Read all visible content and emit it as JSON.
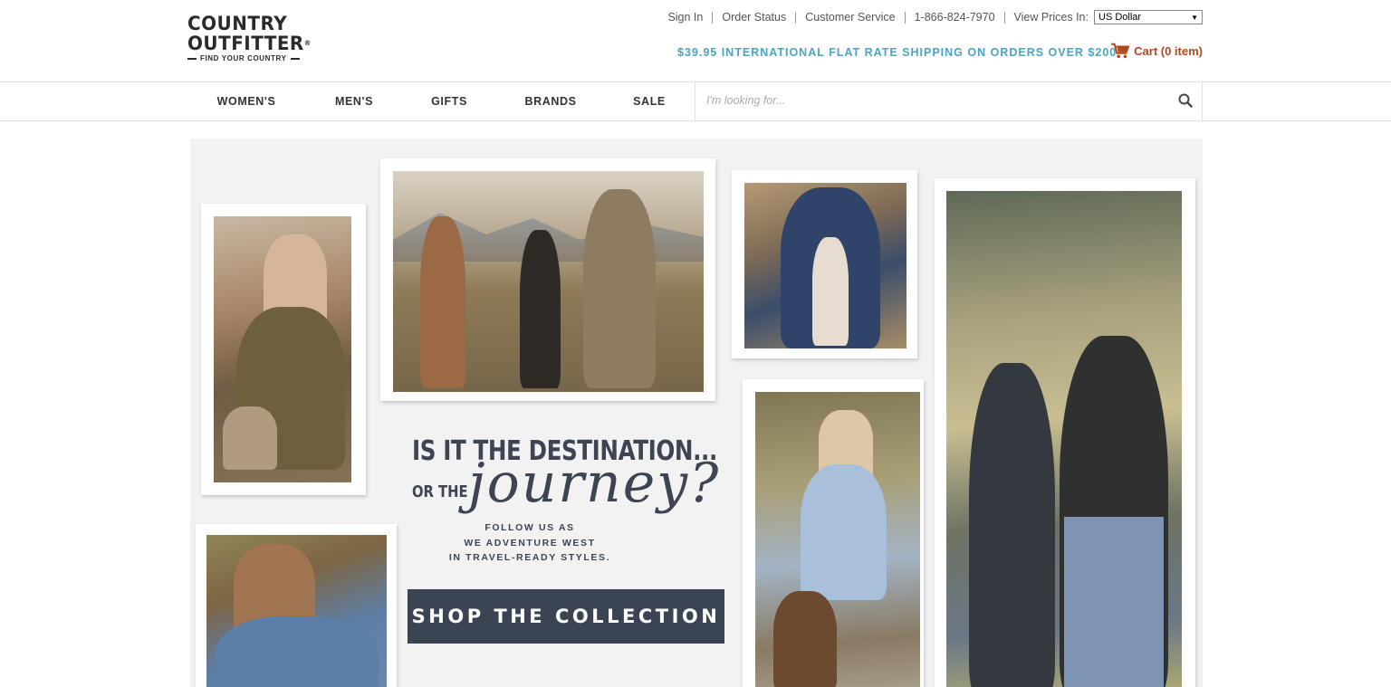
{
  "brand": {
    "line1": "COUNTRY",
    "line2": "OUTFITTER",
    "registered": "®",
    "tagline": "FIND YOUR COUNTRY"
  },
  "util_links": {
    "sign_in": "Sign In",
    "order_status": "Order Status",
    "customer_service": "Customer Service",
    "phone": "1-866-824-7970",
    "view_prices_label": "View Prices In:",
    "currency_value": "US Dollar"
  },
  "promo": "$39.95 INTERNATIONAL FLAT RATE SHIPPING ON ORDERS OVER $200",
  "cart": {
    "label": "Cart (0 item)"
  },
  "nav": {
    "items": [
      {
        "label": "WOMEN'S"
      },
      {
        "label": "MEN'S"
      },
      {
        "label": "GIFTS"
      },
      {
        "label": "BRANDS"
      },
      {
        "label": "SALE"
      }
    ]
  },
  "search": {
    "placeholder": "I'm looking for..."
  },
  "hero": {
    "headline_1": "IS IT THE DESTINATION...",
    "headline_2": "OR THE",
    "headline_script": "journey?",
    "follow_1": "FOLLOW US AS",
    "follow_2": "WE ADVENTURE WEST",
    "follow_3": "IN TRAVEL-READY STYLES.",
    "cta": "SHOP THE COLLECTION"
  },
  "colors": {
    "promo": "#4aa4c6",
    "cart": "#b5471d",
    "cta_bg": "#3b4452",
    "hero_bg": "#f2f2f2"
  }
}
